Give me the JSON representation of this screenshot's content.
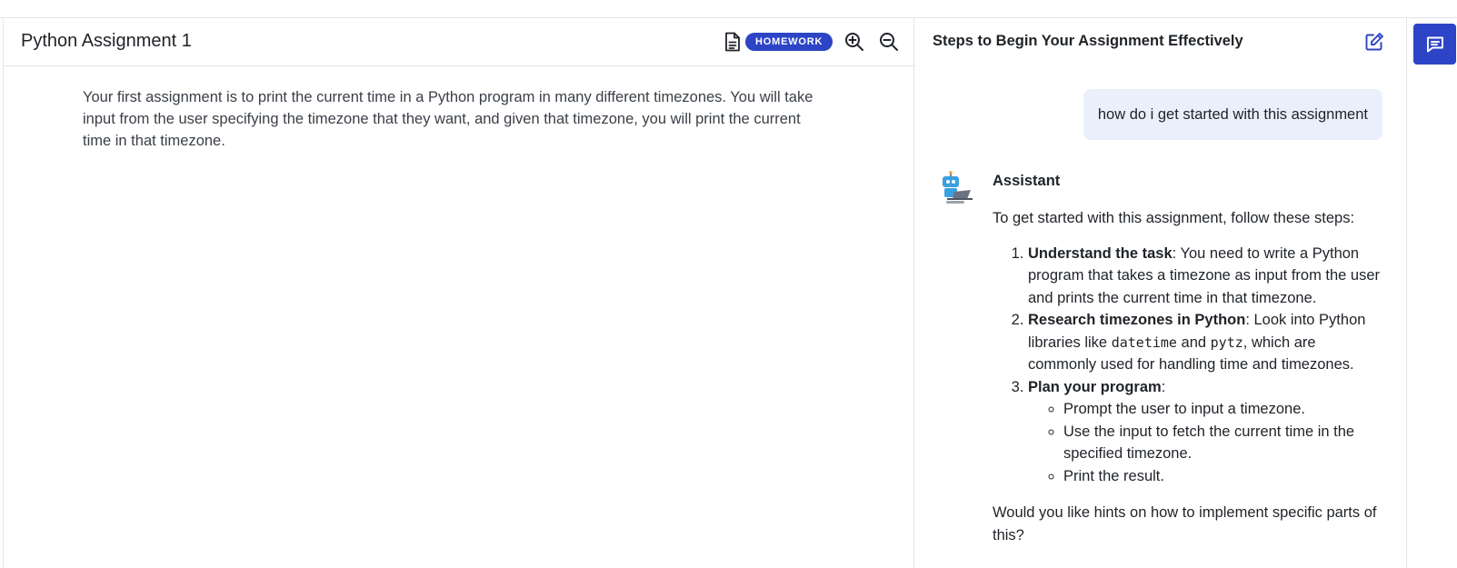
{
  "document": {
    "title": "Python Assignment 1",
    "badge": "HOMEWORK",
    "body": "Your first assignment is to print the current time in a Python program in many different timezones. You will take input from the user specifying the timezone that they want, and given that timezone, you will print the current time in that timezone.",
    "toolbar_icons": [
      "document-icon",
      "zoom-in-icon",
      "zoom-out-icon"
    ]
  },
  "chat": {
    "title": "Steps to Begin Your Assignment Effectively",
    "user_message": "how do i get started with this assignment",
    "assistant_name": "Assistant",
    "intro": "To get started with this assignment, follow these steps:",
    "steps": [
      {
        "title": "Understand the task",
        "text": ": You need to write a Python program that takes a timezone as input from the user and prints the current time in that timezone."
      },
      {
        "title": "Research timezones in Python",
        "text_a": ": Look into Python libraries like ",
        "code_a": "datetime",
        "text_b": " and ",
        "code_b": "pytz",
        "text_c": ", which are commonly used for handling time and timezones."
      },
      {
        "title": "Plan your program",
        "text": ":",
        "subitems": [
          "Prompt the user to input a timezone.",
          "Use the input to fetch the current time in the specified timezone.",
          "Print the result."
        ]
      }
    ],
    "closing": "Would you like hints on how to implement specific parts of this?"
  },
  "colors": {
    "accent": "#2d44c6",
    "user_bubble": "#eaf0fb",
    "border": "#e2e4e8",
    "body_text": "#3a3f47"
  }
}
